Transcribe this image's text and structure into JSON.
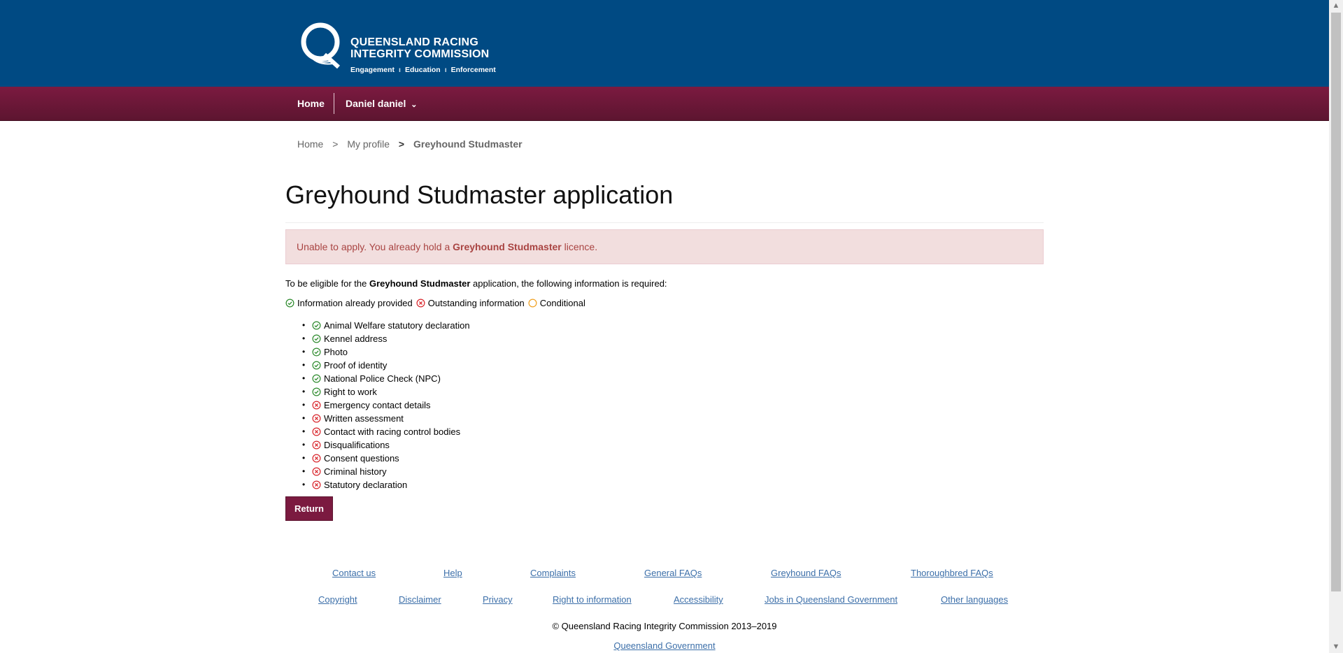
{
  "header": {
    "logo_line1": "QUEENSLAND RACING",
    "logo_line2": "INTEGRITY COMMISSION",
    "logo_tag1": "Engagement",
    "logo_tag2": "Education",
    "logo_tag3": "Enforcement"
  },
  "nav": {
    "home": "Home",
    "user": "Daniel daniel",
    "user_caret": "⌄"
  },
  "breadcrumb": {
    "home": "Home",
    "profile": "My profile",
    "current": "Greyhound Studmaster",
    "sep": ">"
  },
  "page_title": "Greyhound Studmaster application",
  "alert": {
    "prefix": "Unable to apply. You already hold a ",
    "bold": "Greyhound Studmaster",
    "suffix": " licence."
  },
  "intro": {
    "prefix": "To be eligible for the ",
    "bold": "Greyhound Studmaster",
    "suffix": " application, the following information is required:"
  },
  "legend": {
    "provided": "Information already provided",
    "outstanding": "Outstanding information",
    "conditional": "Conditional"
  },
  "requirements": [
    {
      "label": "Animal Welfare statutory declaration",
      "status": "provided"
    },
    {
      "label": "Kennel address",
      "status": "provided"
    },
    {
      "label": "Photo",
      "status": "provided"
    },
    {
      "label": "Proof of identity",
      "status": "provided"
    },
    {
      "label": "National Police Check (NPC)",
      "status": "provided"
    },
    {
      "label": "Right to work",
      "status": "provided"
    },
    {
      "label": "Emergency contact details",
      "status": "outstanding"
    },
    {
      "label": "Written assessment",
      "status": "outstanding"
    },
    {
      "label": "Contact with racing control bodies",
      "status": "outstanding"
    },
    {
      "label": "Disqualifications",
      "status": "outstanding"
    },
    {
      "label": "Consent questions",
      "status": "outstanding"
    },
    {
      "label": "Criminal history",
      "status": "outstanding"
    },
    {
      "label": "Statutory declaration",
      "status": "outstanding"
    }
  ],
  "return_label": "Return",
  "footer": {
    "row1": [
      "Contact us",
      "Help",
      "Complaints",
      "General FAQs",
      "Greyhound FAQs",
      "Thoroughbred FAQs"
    ],
    "row2": [
      "Copyright",
      "Disclaimer",
      "Privacy",
      "Right to information",
      "Accessibility",
      "Jobs in Queensland Government",
      "Other languages"
    ],
    "copyright": "© Queensland Racing Integrity Commission 2013–2019",
    "qgov": "Queensland Government"
  },
  "colors": {
    "header_blue": "#004a83",
    "nav_maroon": "#7b1a40",
    "provided_green": "#2e8b2e",
    "outstanding_red": "#d9262c",
    "conditional_orange": "#f0a020",
    "link_blue": "#3c6fa9"
  },
  "icons": {
    "provided": "check-circle-icon",
    "outstanding": "x-circle-icon",
    "conditional": "empty-circle-icon"
  }
}
